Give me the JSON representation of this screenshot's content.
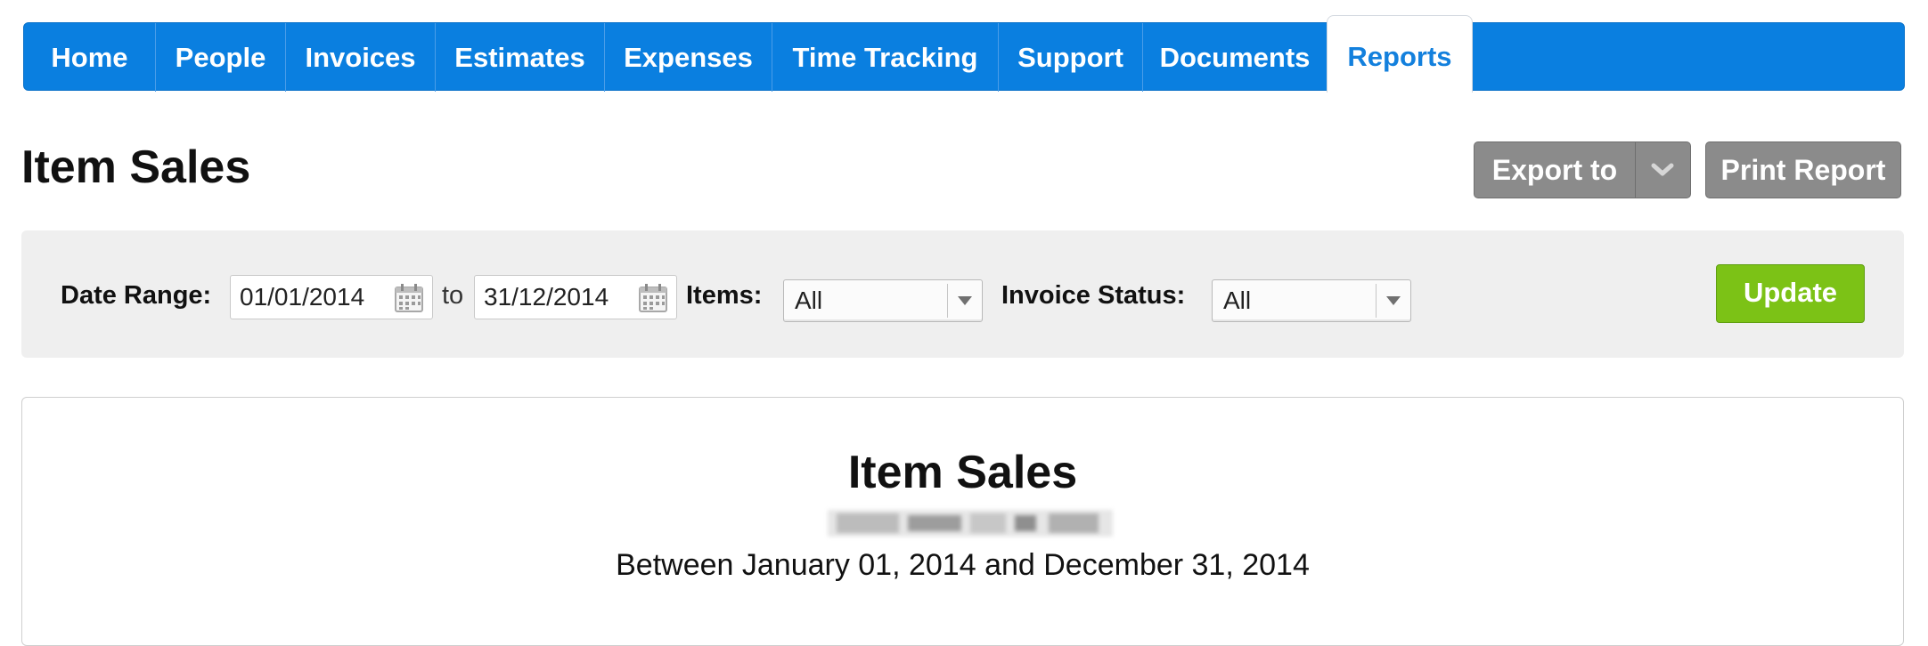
{
  "nav": {
    "tabs": [
      {
        "label": "Home"
      },
      {
        "label": "People"
      },
      {
        "label": "Invoices"
      },
      {
        "label": "Estimates"
      },
      {
        "label": "Expenses"
      },
      {
        "label": "Time Tracking"
      },
      {
        "label": "Support"
      },
      {
        "label": "Documents"
      },
      {
        "label": "Reports",
        "active": true
      }
    ]
  },
  "header": {
    "title": "Item Sales",
    "export_label": "Export to",
    "print_label": "Print Report"
  },
  "filters": {
    "date_range_label": "Date Range:",
    "date_from": "01/01/2014",
    "to_label": "to",
    "date_to": "31/12/2014",
    "items_label": "Items:",
    "items_value": "All",
    "invoice_status_label": "Invoice Status:",
    "invoice_status_value": "All",
    "update_label": "Update"
  },
  "report": {
    "title": "Item Sales",
    "range_text": "Between January 01, 2014 and December 31, 2014"
  },
  "colors": {
    "nav_bg": "#0a7fe0",
    "active_tab_text": "#1380dd",
    "update_button": "#7cc216",
    "grey_button": "#8b8b8b",
    "filter_bg": "#efefef"
  }
}
